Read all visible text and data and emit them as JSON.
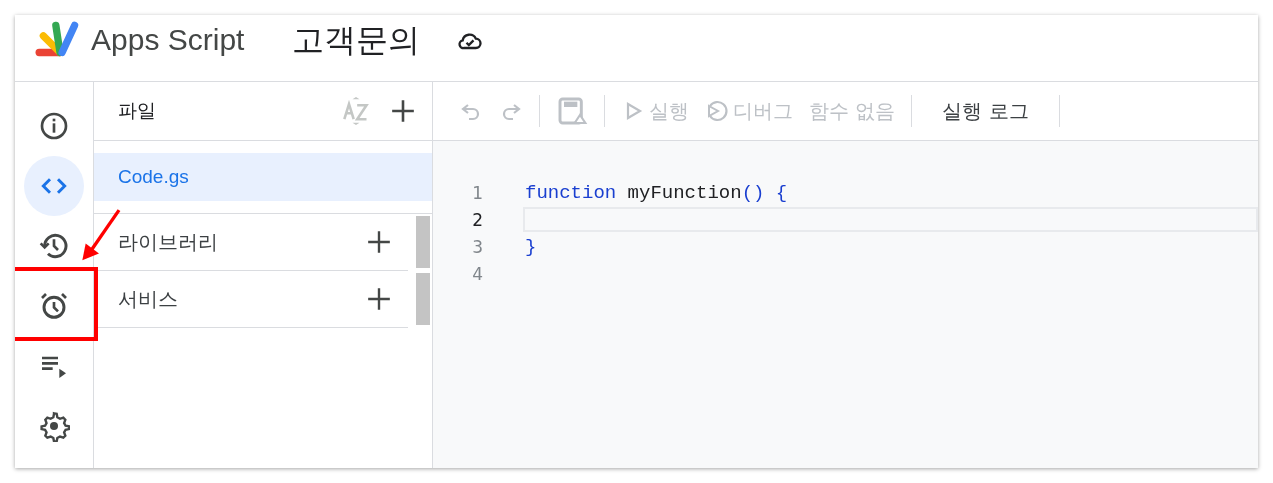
{
  "header": {
    "product": "Apps Script",
    "project_title": "고객문의"
  },
  "rail": [
    {
      "kind": "info",
      "selected": false
    },
    {
      "kind": "code",
      "selected": true
    },
    {
      "kind": "history",
      "selected": false
    },
    {
      "kind": "alarm",
      "selected": false
    },
    {
      "kind": "executions",
      "selected": false
    },
    {
      "kind": "settings",
      "selected": false
    }
  ],
  "files": {
    "title": "파일",
    "items": [
      {
        "name": "Code.gs",
        "selected": true
      }
    ],
    "sections": [
      {
        "label": "라이브러리"
      },
      {
        "label": "서비스"
      }
    ]
  },
  "toolbar": [
    {
      "kind": "undo",
      "disabled": true
    },
    {
      "kind": "redo",
      "disabled": true
    },
    {
      "kind": "save",
      "disabled": true
    },
    {
      "kind": "run",
      "label": "실행",
      "disabled": true
    },
    {
      "kind": "debug",
      "label": "디버그",
      "disabled": true
    },
    {
      "kind": "select",
      "label": "함수 없음",
      "disabled": true
    },
    {
      "kind": "log",
      "label": "실행 로그",
      "disabled": false
    }
  ],
  "editor": {
    "lines": [
      {
        "number": "1",
        "current": false,
        "tokens": [
          {
            "kind": "keyword",
            "text": "function"
          },
          {
            "kind": "name",
            "text": "myFunction"
          },
          {
            "kind": "punct",
            "text": "()"
          },
          {
            "kind": "punct",
            "text": "{"
          }
        ]
      },
      {
        "number": "2",
        "current": true
      },
      {
        "number": "3",
        "current": false,
        "tokens": [
          {
            "kind": "punct",
            "text": "}"
          }
        ]
      },
      {
        "number": "4",
        "current": false
      }
    ]
  }
}
